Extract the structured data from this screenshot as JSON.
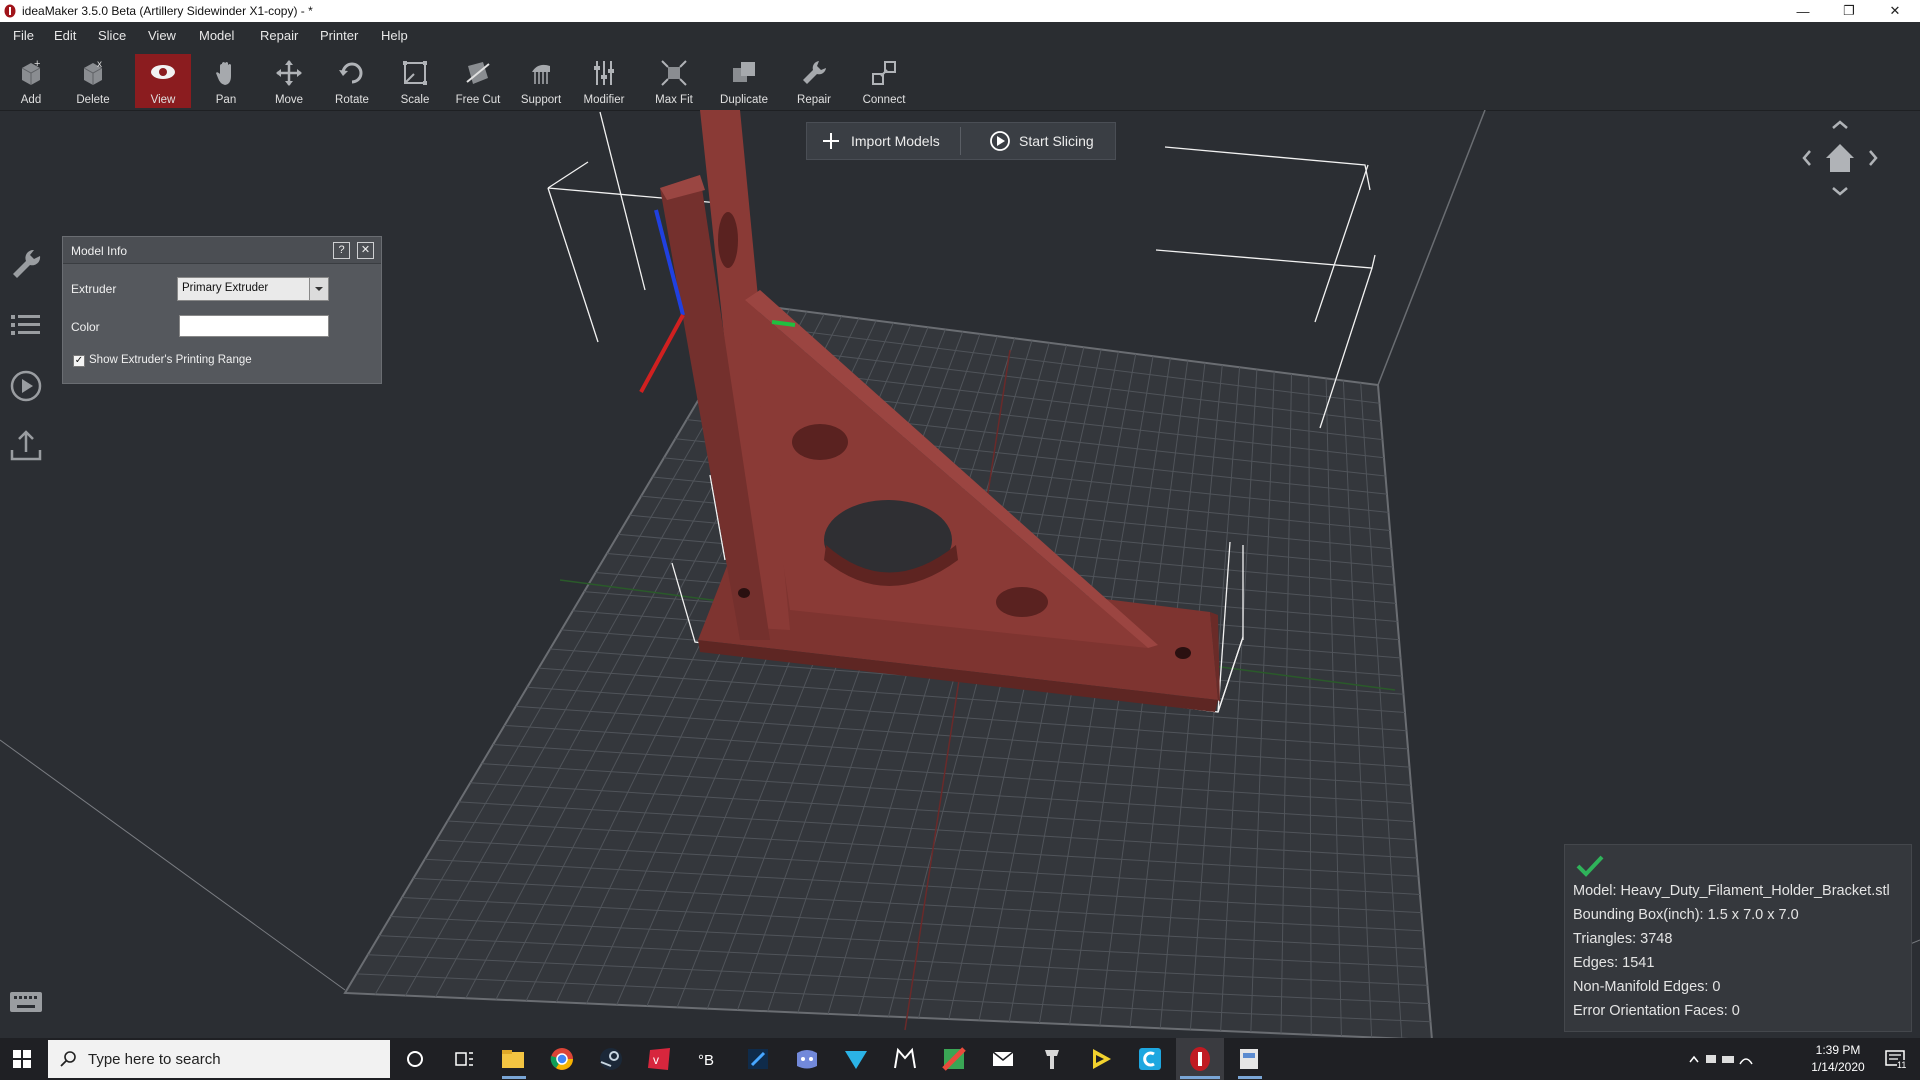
{
  "window": {
    "title": "ideaMaker 3.5.0 Beta (Artillery Sidewinder X1-copy) - *",
    "controls": [
      "minimize-icon",
      "restore-icon",
      "close-icon"
    ]
  },
  "menu": [
    "File",
    "Edit",
    "Slice",
    "View",
    "Model",
    "Repair",
    "Printer",
    "Help"
  ],
  "toolbar": [
    {
      "label": "Add",
      "icon": "add-cube-icon"
    },
    {
      "label": "Delete",
      "icon": "delete-cube-icon"
    },
    {
      "label": "View",
      "icon": "eye-icon",
      "active": true
    },
    {
      "label": "Pan",
      "icon": "hand-icon"
    },
    {
      "label": "Move",
      "icon": "move-arrows-icon"
    },
    {
      "label": "Rotate",
      "icon": "rotate-icon"
    },
    {
      "label": "Scale",
      "icon": "scale-icon"
    },
    {
      "label": "Free Cut",
      "icon": "cut-icon"
    },
    {
      "label": "Support",
      "icon": "support-icon"
    },
    {
      "label": "Modifier",
      "icon": "sliders-icon"
    },
    {
      "label": "Max Fit",
      "icon": "maxfit-icon"
    },
    {
      "label": "Duplicate",
      "icon": "duplicate-icon"
    },
    {
      "label": "Repair",
      "icon": "wrench-icon"
    },
    {
      "label": "Connect",
      "icon": "connect-icon"
    }
  ],
  "actions": {
    "import_label": "Import Models",
    "slice_label": "Start Slicing"
  },
  "left_rail": [
    "wrench-icon",
    "list-icon",
    "play-icon",
    "upload-icon",
    "keyboard-icon"
  ],
  "model_info": {
    "title": "Model Info",
    "help": "?",
    "close": "✕",
    "extruder_label": "Extruder",
    "extruder_value": "Primary Extruder",
    "color_label": "Color",
    "color_value": "#ffffff",
    "show_range_label": "Show Extruder's Printing Range",
    "show_range_checked": true
  },
  "info": {
    "status_icon": "checkmark-icon",
    "model": "Model: Heavy_Duty_Filament_Holder_Bracket.stl",
    "bbox": "Bounding Box(inch): 1.5 x 7.0 x 7.0",
    "triangles": "Triangles: 3748",
    "edges": "Edges: 1541",
    "nonmanifold": "Non-Manifold Edges: 0",
    "error_faces": "Error Orientation Faces: 0"
  },
  "taskbar": {
    "search_placeholder": "Type here to search",
    "time": "1:39 PM",
    "date": "1/14/2020",
    "notification_count": "11"
  },
  "colors": {
    "model": "#8a3a36",
    "accent_active": "#8b1c1f",
    "background": "#2b2e33",
    "check_green": "#2fb35a"
  }
}
